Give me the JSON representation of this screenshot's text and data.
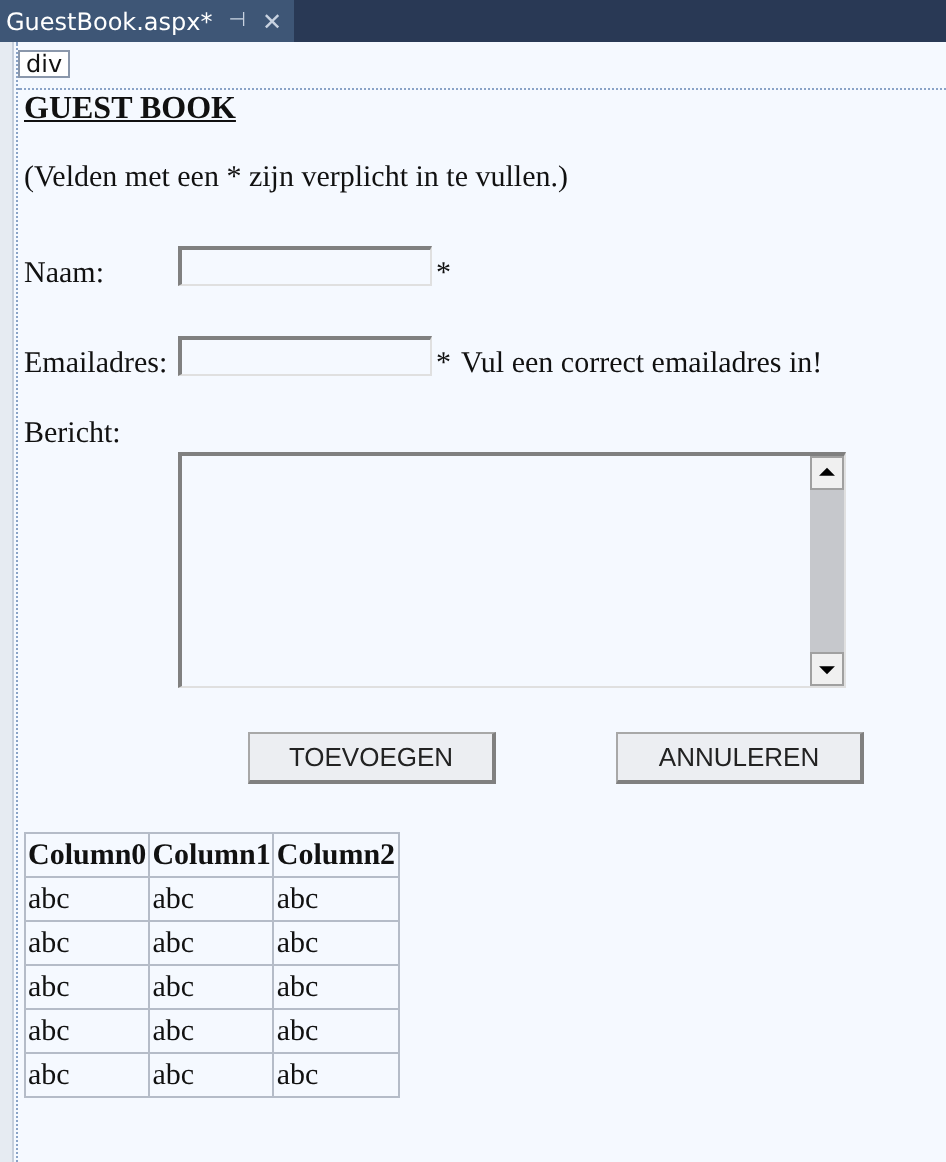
{
  "tab": {
    "title": "GuestBook.aspx*",
    "pin": "⊣",
    "close": "✕"
  },
  "tag_label": "div",
  "heading": "GUEST BOOK",
  "note": "(Velden met een * zijn verplicht in te vullen.)",
  "fields": [
    {
      "kind": "text",
      "label": "Naam:",
      "marker": "*"
    },
    {
      "kind": "text",
      "label": "Emailadres:",
      "marker": "*",
      "message": "Vul een correct emailadres in!"
    },
    {
      "kind": "textarea",
      "label": "Bericht:"
    }
  ],
  "buttons": [
    "TOEVOEGEN",
    "ANNULEREN"
  ],
  "table": {
    "columns": [
      "Column0",
      "Column1",
      "Column2"
    ],
    "rows": [
      [
        "abc",
        "abc",
        "abc"
      ],
      [
        "abc",
        "abc",
        "abc"
      ],
      [
        "abc",
        "abc",
        "abc"
      ],
      [
        "abc",
        "abc",
        "abc"
      ],
      [
        "abc",
        "abc",
        "abc"
      ]
    ]
  }
}
